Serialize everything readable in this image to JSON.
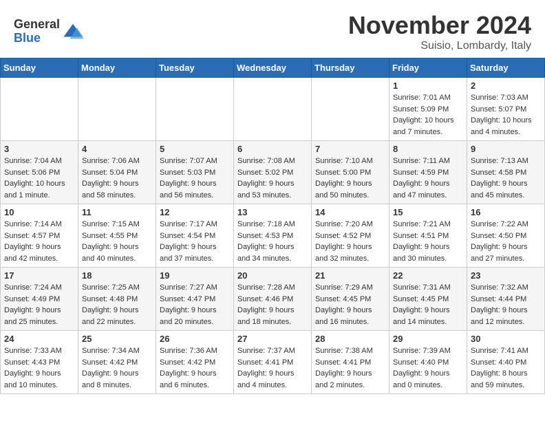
{
  "header": {
    "logo_general": "General",
    "logo_blue": "Blue",
    "month_title": "November 2024",
    "location": "Suisio, Lombardy, Italy"
  },
  "columns": [
    "Sunday",
    "Monday",
    "Tuesday",
    "Wednesday",
    "Thursday",
    "Friday",
    "Saturday"
  ],
  "weeks": [
    [
      {
        "day": "",
        "info": ""
      },
      {
        "day": "",
        "info": ""
      },
      {
        "day": "",
        "info": ""
      },
      {
        "day": "",
        "info": ""
      },
      {
        "day": "",
        "info": ""
      },
      {
        "day": "1",
        "info": "Sunrise: 7:01 AM\nSunset: 5:09 PM\nDaylight: 10 hours and 7 minutes."
      },
      {
        "day": "2",
        "info": "Sunrise: 7:03 AM\nSunset: 5:07 PM\nDaylight: 10 hours and 4 minutes."
      }
    ],
    [
      {
        "day": "3",
        "info": "Sunrise: 7:04 AM\nSunset: 5:06 PM\nDaylight: 10 hours and 1 minute."
      },
      {
        "day": "4",
        "info": "Sunrise: 7:06 AM\nSunset: 5:04 PM\nDaylight: 9 hours and 58 minutes."
      },
      {
        "day": "5",
        "info": "Sunrise: 7:07 AM\nSunset: 5:03 PM\nDaylight: 9 hours and 56 minutes."
      },
      {
        "day": "6",
        "info": "Sunrise: 7:08 AM\nSunset: 5:02 PM\nDaylight: 9 hours and 53 minutes."
      },
      {
        "day": "7",
        "info": "Sunrise: 7:10 AM\nSunset: 5:00 PM\nDaylight: 9 hours and 50 minutes."
      },
      {
        "day": "8",
        "info": "Sunrise: 7:11 AM\nSunset: 4:59 PM\nDaylight: 9 hours and 47 minutes."
      },
      {
        "day": "9",
        "info": "Sunrise: 7:13 AM\nSunset: 4:58 PM\nDaylight: 9 hours and 45 minutes."
      }
    ],
    [
      {
        "day": "10",
        "info": "Sunrise: 7:14 AM\nSunset: 4:57 PM\nDaylight: 9 hours and 42 minutes."
      },
      {
        "day": "11",
        "info": "Sunrise: 7:15 AM\nSunset: 4:55 PM\nDaylight: 9 hours and 40 minutes."
      },
      {
        "day": "12",
        "info": "Sunrise: 7:17 AM\nSunset: 4:54 PM\nDaylight: 9 hours and 37 minutes."
      },
      {
        "day": "13",
        "info": "Sunrise: 7:18 AM\nSunset: 4:53 PM\nDaylight: 9 hours and 34 minutes."
      },
      {
        "day": "14",
        "info": "Sunrise: 7:20 AM\nSunset: 4:52 PM\nDaylight: 9 hours and 32 minutes."
      },
      {
        "day": "15",
        "info": "Sunrise: 7:21 AM\nSunset: 4:51 PM\nDaylight: 9 hours and 30 minutes."
      },
      {
        "day": "16",
        "info": "Sunrise: 7:22 AM\nSunset: 4:50 PM\nDaylight: 9 hours and 27 minutes."
      }
    ],
    [
      {
        "day": "17",
        "info": "Sunrise: 7:24 AM\nSunset: 4:49 PM\nDaylight: 9 hours and 25 minutes."
      },
      {
        "day": "18",
        "info": "Sunrise: 7:25 AM\nSunset: 4:48 PM\nDaylight: 9 hours and 22 minutes."
      },
      {
        "day": "19",
        "info": "Sunrise: 7:27 AM\nSunset: 4:47 PM\nDaylight: 9 hours and 20 minutes."
      },
      {
        "day": "20",
        "info": "Sunrise: 7:28 AM\nSunset: 4:46 PM\nDaylight: 9 hours and 18 minutes."
      },
      {
        "day": "21",
        "info": "Sunrise: 7:29 AM\nSunset: 4:45 PM\nDaylight: 9 hours and 16 minutes."
      },
      {
        "day": "22",
        "info": "Sunrise: 7:31 AM\nSunset: 4:45 PM\nDaylight: 9 hours and 14 minutes."
      },
      {
        "day": "23",
        "info": "Sunrise: 7:32 AM\nSunset: 4:44 PM\nDaylight: 9 hours and 12 minutes."
      }
    ],
    [
      {
        "day": "24",
        "info": "Sunrise: 7:33 AM\nSunset: 4:43 PM\nDaylight: 9 hours and 10 minutes."
      },
      {
        "day": "25",
        "info": "Sunrise: 7:34 AM\nSunset: 4:42 PM\nDaylight: 9 hours and 8 minutes."
      },
      {
        "day": "26",
        "info": "Sunrise: 7:36 AM\nSunset: 4:42 PM\nDaylight: 9 hours and 6 minutes."
      },
      {
        "day": "27",
        "info": "Sunrise: 7:37 AM\nSunset: 4:41 PM\nDaylight: 9 hours and 4 minutes."
      },
      {
        "day": "28",
        "info": "Sunrise: 7:38 AM\nSunset: 4:41 PM\nDaylight: 9 hours and 2 minutes."
      },
      {
        "day": "29",
        "info": "Sunrise: 7:39 AM\nSunset: 4:40 PM\nDaylight: 9 hours and 0 minutes."
      },
      {
        "day": "30",
        "info": "Sunrise: 7:41 AM\nSunset: 4:40 PM\nDaylight: 8 hours and 59 minutes."
      }
    ]
  ]
}
